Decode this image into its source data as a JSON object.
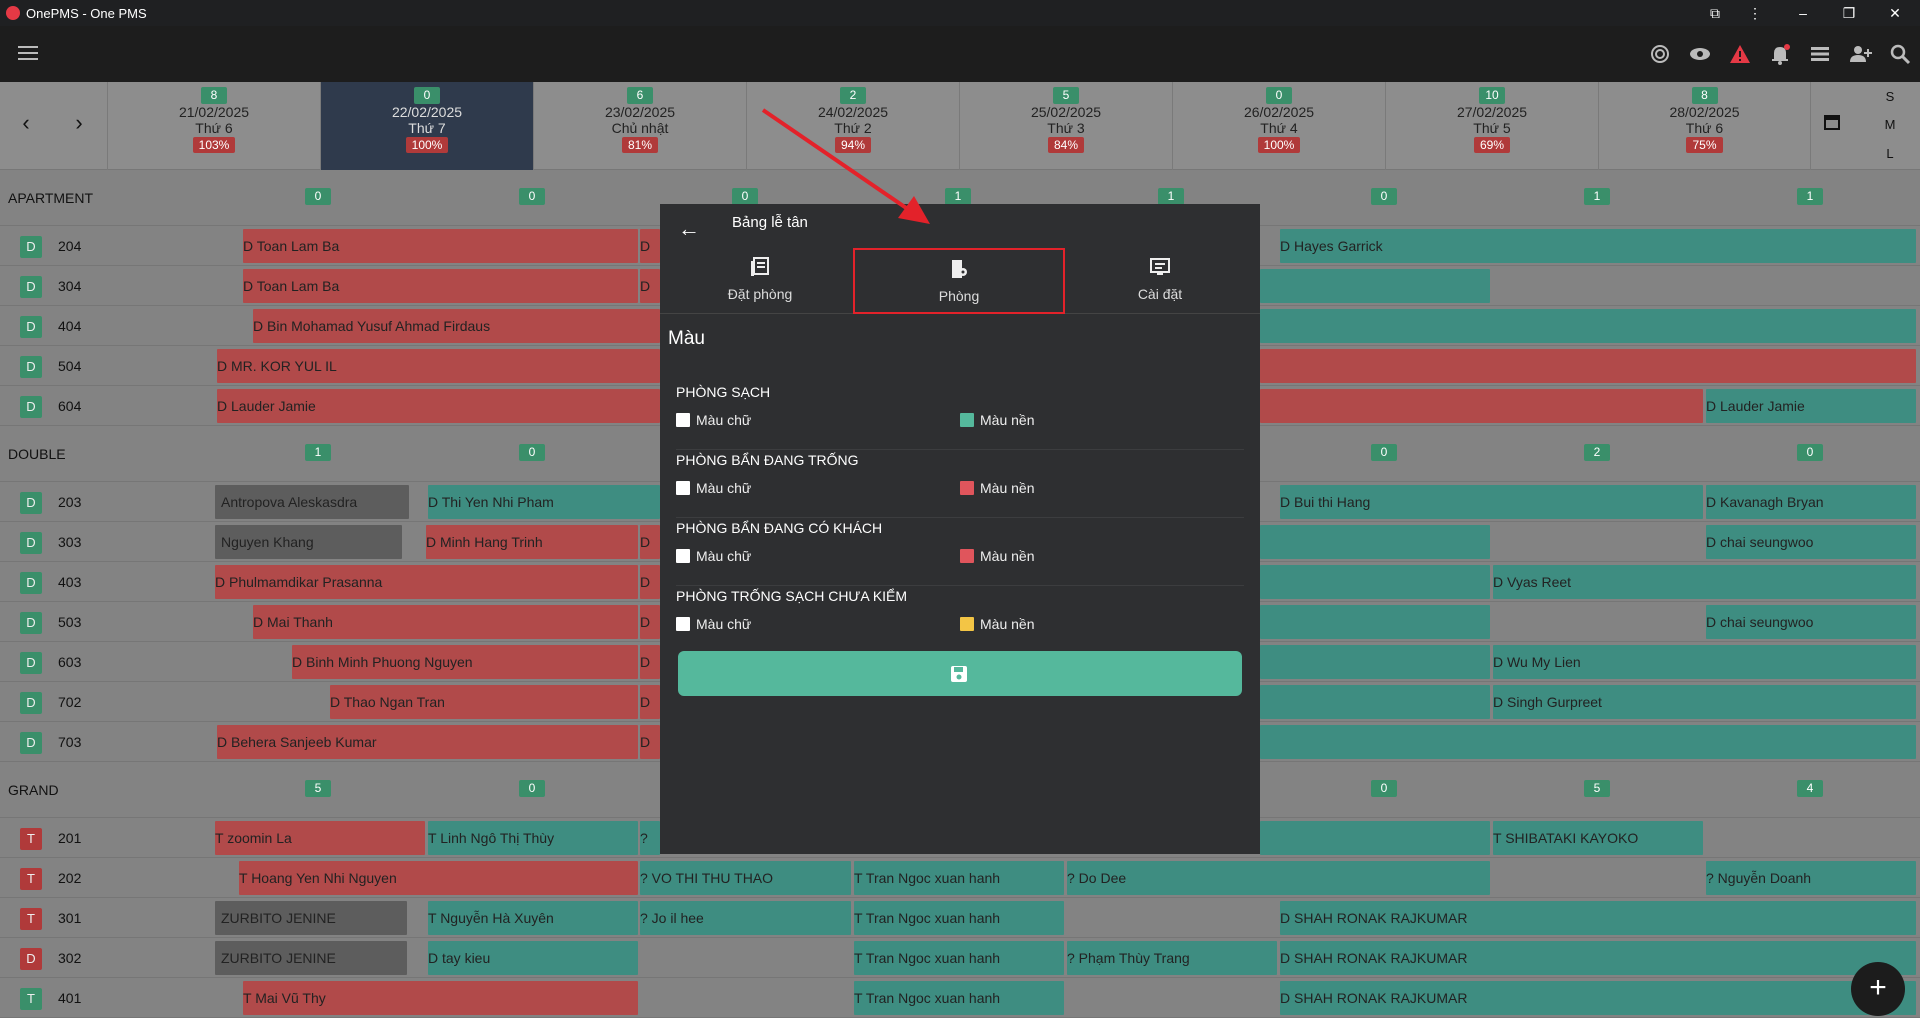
{
  "window": {
    "title": "OnePMS - One PMS"
  },
  "days": [
    {
      "count": "8",
      "date": "21/02/2025",
      "weekday": "Thứ 6",
      "pct": "103%"
    },
    {
      "count": "0",
      "date": "22/02/2025",
      "weekday": "Thứ 7",
      "pct": "100%"
    },
    {
      "count": "6",
      "date": "23/02/2025",
      "weekday": "Chủ nhật",
      "pct": "81%"
    },
    {
      "count": "2",
      "date": "24/02/2025",
      "weekday": "Thứ 2",
      "pct": "94%"
    },
    {
      "count": "5",
      "date": "25/02/2025",
      "weekday": "Thứ 3",
      "pct": "84%"
    },
    {
      "count": "0",
      "date": "26/02/2025",
      "weekday": "Thứ 4",
      "pct": "100%"
    },
    {
      "count": "10",
      "date": "27/02/2025",
      "weekday": "Thứ 5",
      "pct": "69%"
    },
    {
      "count": "8",
      "date": "28/02/2025",
      "weekday": "Thứ 6",
      "pct": "75%"
    }
  ],
  "size_toggle": [
    "S",
    "M",
    "L"
  ],
  "groups": {
    "apartment": {
      "name": "APARTMENT",
      "counts": [
        "0",
        "0",
        "0",
        "1",
        "1",
        "0",
        "1",
        "1"
      ]
    },
    "double": {
      "name": "DOUBLE",
      "counts": [
        "1",
        "0",
        "0",
        "0",
        "2",
        "0"
      ]
    },
    "grand": {
      "name": "GRAND",
      "counts": [
        "5",
        "0",
        "0",
        "5",
        "4"
      ]
    }
  },
  "rooms": [
    {
      "type": "D",
      "num": "204"
    },
    {
      "type": "D",
      "num": "304"
    },
    {
      "type": "D",
      "num": "404"
    },
    {
      "type": "D",
      "num": "504"
    },
    {
      "type": "D",
      "num": "604"
    },
    {
      "type": "D",
      "num": "203"
    },
    {
      "type": "D",
      "num": "303"
    },
    {
      "type": "D",
      "num": "403"
    },
    {
      "type": "D",
      "num": "503"
    },
    {
      "type": "D",
      "num": "603"
    },
    {
      "type": "D",
      "num": "702"
    },
    {
      "type": "D",
      "num": "703"
    },
    {
      "type": "T",
      "num": "201"
    },
    {
      "type": "T",
      "num": "202"
    },
    {
      "type": "T",
      "num": "301"
    },
    {
      "type": "D",
      "num": "302"
    },
    {
      "type": "T",
      "num": "401"
    }
  ],
  "bookings": {
    "r204a": "D Toan Lam Ba",
    "r204b": "D",
    "r204c": "D Hayes Garrick",
    "r304a": "D Toan Lam Ba",
    "r304b": "D",
    "r404a": "D Bin Mohamad Yusuf Ahmad Firdaus",
    "r504a": "D MR. KOR YUL IL",
    "r604a": "D Lauder Jamie",
    "r604b": "D Lauder Jamie",
    "r203a": "Antropova Aleskasdra",
    "r203b": "D Thi Yen Nhi Pham",
    "r203c": "D Bui thi Hang",
    "r203d": "D Kavanagh Bryan",
    "r303a": "Nguyen Khang",
    "r303b": "D Minh Hang Trinh",
    "r303c": "D",
    "r303d": "D chai seungwoo",
    "r403a": "D Phulmamdikar Prasanna",
    "r403b": "D",
    "r403c": "D Vyas Reet",
    "r503a": "D Mai Thanh",
    "r503b": "D",
    "r503c": "D chai seungwoo",
    "r603a": "D Binh Minh Phuong Nguyen",
    "r603b": "D",
    "r603c": "D Wu My Lien",
    "r702a": "D Thao Ngan Tran",
    "r702b": "D",
    "r702c": "D Singh Gurpreet",
    "r703a": "D Behera Sanjeeb Kumar",
    "r703b": "D",
    "r201a": "T zoomin La",
    "r201b": "T Linh Ngô Thị Thùy",
    "r201c": "?",
    "r201d": "T SHIBATAKI KAYOKO",
    "r202a": "T Hoang Yen Nhi Nguyen",
    "r202b": "? VO THI THU THAO",
    "r202c": "T Tran Ngoc xuan hanh",
    "r202d": "? Do Dee",
    "r202e": "? Nguyễn Doanh",
    "r301a": "ZURBITO JENINE",
    "r301b": "T Nguyễn Hà Xuyên",
    "r301c": "? Jo il hee",
    "r301d": "T Tran Ngoc xuan hanh",
    "r301e": "D SHAH RONAK RAJKUMAR",
    "r302a": "ZURBITO JENINE",
    "r302b": "D tay kieu",
    "r302c": "T Tran Ngoc xuan hanh",
    "r302d": "? Phạm Thùy Trang",
    "r302e": "D SHAH RONAK RAJKUMAR",
    "r401a": "T Mai Vũ Thy",
    "r401b": "T Tran Ngoc xuan hanh",
    "r401c": "D SHAH RONAK RAJKUMAR"
  },
  "panel": {
    "title": "Bảng lễ tân",
    "tabs": [
      {
        "label": "Đặt phòng",
        "icon": "booking-list-icon"
      },
      {
        "label": "Phòng",
        "icon": "room-settings-icon"
      },
      {
        "label": "Cài đặt",
        "icon": "settings-monitor-icon"
      }
    ],
    "section": "Màu",
    "color_groups": [
      {
        "title": "PHÒNG SẠCH",
        "text_label": "Màu chữ",
        "bg_label": "Màu nền",
        "text_color": "#ffffff",
        "bg_color": "#55b89c"
      },
      {
        "title": "PHÒNG BẨN ĐANG TRỐNG",
        "text_label": "Màu chữ",
        "bg_label": "Màu nền",
        "text_color": "#ffffff",
        "bg_color": "#e0555c"
      },
      {
        "title": "PHÒNG BẨN ĐANG CÓ KHÁCH",
        "text_label": "Màu chữ",
        "bg_label": "Màu nền",
        "text_color": "#ffffff",
        "bg_color": "#e0555c"
      },
      {
        "title": "PHÒNG TRỐNG SẠCH CHƯA KIỂM",
        "text_label": "Màu chữ",
        "bg_label": "Màu nền",
        "text_color": "#ffffff",
        "bg_color": "#f3c545"
      }
    ],
    "save_icon": "save-icon"
  },
  "fab": {
    "label": "+"
  }
}
